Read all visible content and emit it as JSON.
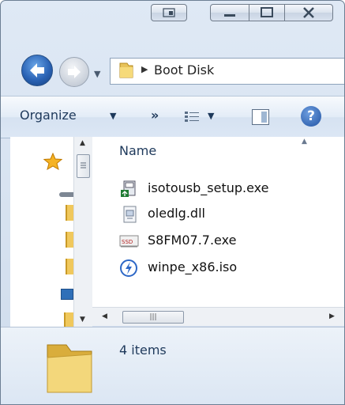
{
  "window": {
    "caption_buttons": [
      "restore-side",
      "minimize",
      "maximize",
      "close"
    ],
    "accent": "#2a63b5"
  },
  "address": {
    "breadcrumb": "Boot Disk"
  },
  "toolbar": {
    "organize_label": "Organize"
  },
  "file_list": {
    "column_header": "Name",
    "files": [
      {
        "name": "isotousb_setup.exe",
        "icon": "installer-icon"
      },
      {
        "name": "oledlg.dll",
        "icon": "dll-icon"
      },
      {
        "name": "S8FM07.7.exe",
        "icon": "ssd-exe-icon"
      },
      {
        "name": "winpe_x86.iso",
        "icon": "iso-icon"
      }
    ]
  },
  "details": {
    "item_count": "4 items"
  }
}
